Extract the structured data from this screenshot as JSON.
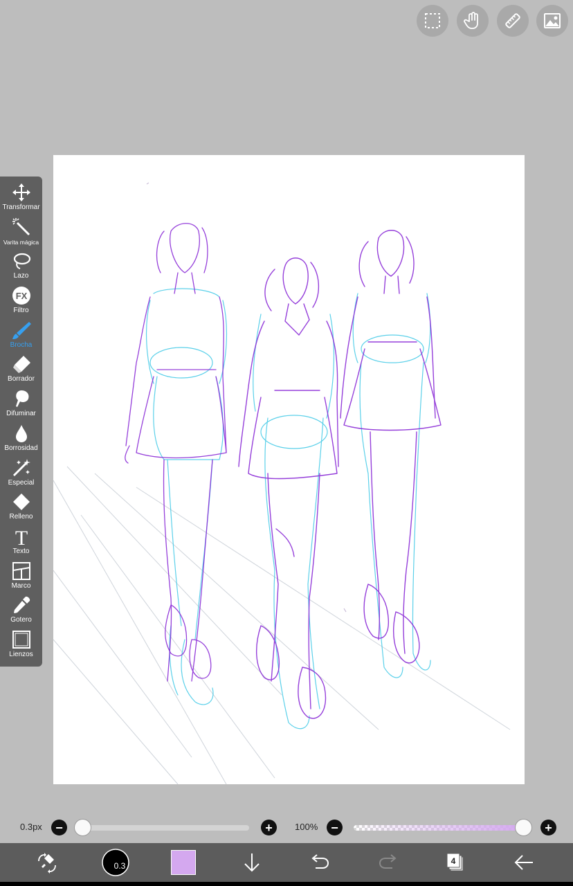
{
  "top_buttons": [
    {
      "name": "selection-icon"
    },
    {
      "name": "hand-icon"
    },
    {
      "name": "ruler-icon"
    },
    {
      "name": "image-icon"
    }
  ],
  "tools": [
    {
      "name": "tool-transform",
      "label": "Transformar",
      "icon": "move-icon",
      "active": false
    },
    {
      "name": "tool-magic-wand",
      "label": "Varita mágica",
      "icon": "magic-wand-icon",
      "active": false
    },
    {
      "name": "tool-lasso",
      "label": "Lazo",
      "icon": "lasso-icon",
      "active": false
    },
    {
      "name": "tool-filter",
      "label": "Filtro",
      "icon": "fx-icon",
      "icon_text": "FX",
      "active": false
    },
    {
      "name": "tool-brush",
      "label": "Brocha",
      "icon": "brush-icon",
      "active": true
    },
    {
      "name": "tool-eraser",
      "label": "Borrador",
      "icon": "eraser-icon",
      "active": false
    },
    {
      "name": "tool-smudge",
      "label": "Difuminar",
      "icon": "smudge-icon",
      "active": false
    },
    {
      "name": "tool-blur",
      "label": "Borrosidad",
      "icon": "drop-icon",
      "active": false
    },
    {
      "name": "tool-special",
      "label": "Especial",
      "icon": "special-icon",
      "active": false
    },
    {
      "name": "tool-fill",
      "label": "Relleno",
      "icon": "fill-icon",
      "active": false
    },
    {
      "name": "tool-text",
      "label": "Texto",
      "icon": "text-icon",
      "icon_text": "T",
      "active": false
    },
    {
      "name": "tool-frame",
      "label": "Marco",
      "icon": "frame-icon",
      "active": false
    },
    {
      "name": "tool-eyedropper",
      "label": "Gotero",
      "icon": "eyedropper-icon",
      "active": false
    },
    {
      "name": "tool-canvas",
      "label": "Lienzos",
      "icon": "canvas-icon",
      "active": false
    }
  ],
  "brush_size": {
    "label": "0.3px",
    "minus": "−",
    "plus": "+",
    "level": 0.0
  },
  "opacity": {
    "label": "100%",
    "minus": "−",
    "plus": "+",
    "level": 1.0
  },
  "bottom_bar": {
    "brush_size_badge": "0.3",
    "layer_count": "4",
    "color": "#d4a8ef"
  },
  "colors": {
    "accent": "#36a0f0",
    "sketch_purple": "#8a2bd6",
    "sketch_cyan": "#3ec8e6"
  }
}
